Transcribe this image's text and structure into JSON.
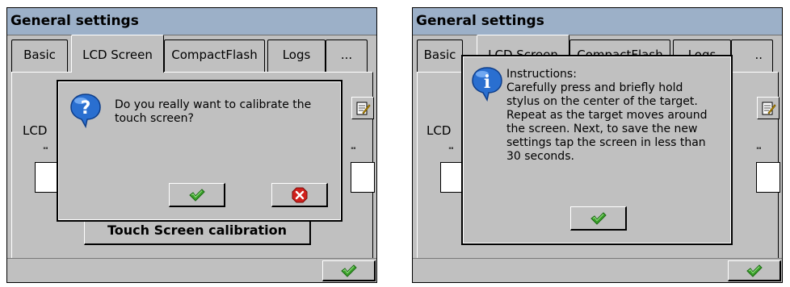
{
  "left": {
    "title": "General settings",
    "tabs": [
      "Basic",
      "LCD Screen",
      "CompactFlash",
      "Logs",
      "..."
    ],
    "active_tab": "LCD Screen",
    "background_label": "LCD",
    "tick_marks_left": "''''",
    "tick_marks_right": "''''",
    "touch_button_label": "Touch Screen calibration",
    "dialog": {
      "message_line1": "Do you really want to calibrate the",
      "message_line2": "touch screen?",
      "icon": "question-icon",
      "ok_icon": "checkmark-icon",
      "cancel_icon": "cancel-icon"
    },
    "ok_icon": "checkmark-icon"
  },
  "right": {
    "title": "General settings",
    "tabs": [
      "Basic",
      "LCD Screen",
      "CompactFlash",
      "Logs",
      ".."
    ],
    "background_label": "LCD",
    "tick_marks_left": "''''",
    "tick_marks_right": "''''",
    "dialog": {
      "lines": [
        "Instructions:",
        "Carefully press and briefly hold",
        "stylus on the center of the target.",
        "Repeat as the target moves around",
        "the screen. Next, to save the new",
        "settings tap the screen in less than",
        "30 seconds."
      ],
      "icon": "info-icon",
      "ok_icon": "checkmark-icon"
    },
    "ok_icon": "checkmark-icon"
  },
  "colors": {
    "window_bg": "#c0c0c0",
    "title_bg": "#9cb0c8",
    "check_green": "#3aa02a",
    "cancel_red": "#d0201c",
    "icon_blue": "#2a6fd0"
  }
}
